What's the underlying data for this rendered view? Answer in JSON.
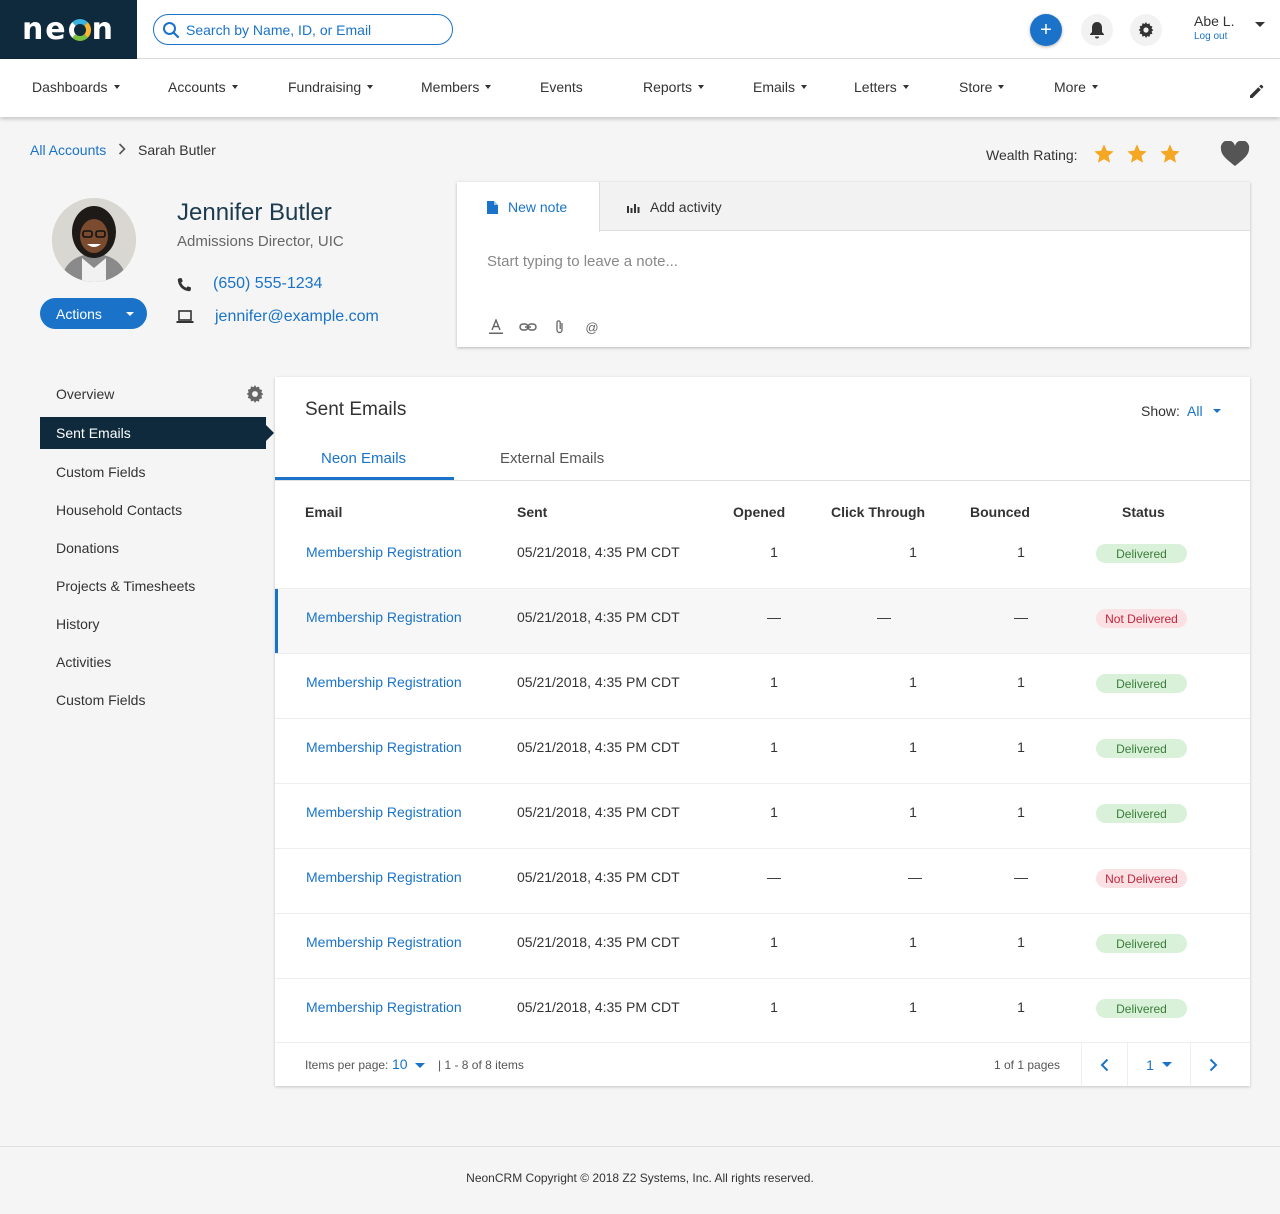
{
  "header": {
    "logo_text": "neon",
    "search_placeholder": "Search by Name, ID, or Email",
    "add_button": "+",
    "user_name": "Abe L.",
    "logout_label": "Log out"
  },
  "nav": {
    "items": [
      {
        "label": "Dashboards",
        "dropdown": true
      },
      {
        "label": "Accounts",
        "dropdown": true
      },
      {
        "label": "Fundraising",
        "dropdown": true
      },
      {
        "label": "Members",
        "dropdown": true
      },
      {
        "label": "Events",
        "dropdown": false
      },
      {
        "label": "Reports",
        "dropdown": true
      },
      {
        "label": "Emails",
        "dropdown": true
      },
      {
        "label": "Letters",
        "dropdown": true
      },
      {
        "label": "Store",
        "dropdown": true
      },
      {
        "label": "More",
        "dropdown": true
      }
    ]
  },
  "breadcrumb": {
    "parent": "All Accounts",
    "current": "Sarah Butler"
  },
  "wealth": {
    "label": "Wealth Rating:",
    "stars": 3,
    "star_color": "#f5a623"
  },
  "profile": {
    "name": "Jennifer Butler",
    "title": "Admissions Director, UIC",
    "phone": "(650) 555-1234",
    "email": "jennifer@example.com",
    "actions_label": "Actions"
  },
  "note": {
    "tab_new_note": "New note",
    "tab_add_activity": "Add activity",
    "placeholder": "Start typing to leave a note...",
    "mention_symbol": "@"
  },
  "sidebar": {
    "items": [
      {
        "label": "Overview",
        "active": false
      },
      {
        "label": "Sent Emails",
        "active": true
      },
      {
        "label": "Custom Fields",
        "active": false
      },
      {
        "label": "Household Contacts",
        "active": false
      },
      {
        "label": "Donations",
        "active": false
      },
      {
        "label": "Projects & Timesheets",
        "active": false
      },
      {
        "label": "History",
        "active": false
      },
      {
        "label": "Activities",
        "active": false
      },
      {
        "label": "Custom Fields",
        "active": false
      }
    ]
  },
  "panel": {
    "title": "Sent Emails",
    "show_label": "Show:",
    "show_value": "All",
    "tabs": [
      "Neon Emails",
      "External Emails"
    ],
    "columns": [
      "Email",
      "Sent",
      "Opened",
      "Click Through",
      "Bounced",
      "Status"
    ],
    "rows": [
      {
        "email": "Membership Registration",
        "sent": "05/21/2018, 4:35 PM CDT",
        "opened": "1",
        "click": "1",
        "bounced": "1",
        "status": "Delivered",
        "ok": true
      },
      {
        "email": "Membership Registration",
        "sent": "05/21/2018, 4:35 PM CDT",
        "opened": "—",
        "click": "—",
        "bounced": "—",
        "status": "Not Delivered",
        "ok": false
      },
      {
        "email": "Membership Registration",
        "sent": "05/21/2018, 4:35 PM CDT",
        "opened": "1",
        "click": "1",
        "bounced": "1",
        "status": "Delivered",
        "ok": true
      },
      {
        "email": "Membership Registration",
        "sent": "05/21/2018, 4:35 PM CDT",
        "opened": "1",
        "click": "1",
        "bounced": "1",
        "status": "Delivered",
        "ok": true
      },
      {
        "email": "Membership Registration",
        "sent": "05/21/2018, 4:35 PM CDT",
        "opened": "1",
        "click": "1",
        "bounced": "1",
        "status": "Delivered",
        "ok": true
      },
      {
        "email": "Membership Registration",
        "sent": "05/21/2018, 4:35 PM CDT",
        "opened": "—",
        "click": "—",
        "bounced": "—",
        "status": "Not Delivered",
        "ok": false
      },
      {
        "email": "Membership Registration",
        "sent": "05/21/2018, 4:35 PM CDT",
        "opened": "1",
        "click": "1",
        "bounced": "1",
        "status": "Delivered",
        "ok": true
      },
      {
        "email": "Membership Registration",
        "sent": "05/21/2018, 4:35 PM CDT",
        "opened": "1",
        "click": "1",
        "bounced": "1",
        "status": "Delivered",
        "ok": true
      }
    ],
    "pager": {
      "items_per_page_label": "Items per page:",
      "items_per_page": "10",
      "range": "| 1 - 8 of 8 items",
      "pages": "1 of 1 pages",
      "current_page": "1"
    }
  },
  "footer": {
    "text": "NeonCRM Copyright © 2018 Z2 Systems, Inc. All rights reserved."
  },
  "colors": {
    "brand_dark": "#0e2a3c",
    "accent": "#1a73c9",
    "delivered_bg": "#d9f0d9",
    "not_delivered_bg": "#fbe0e4"
  }
}
